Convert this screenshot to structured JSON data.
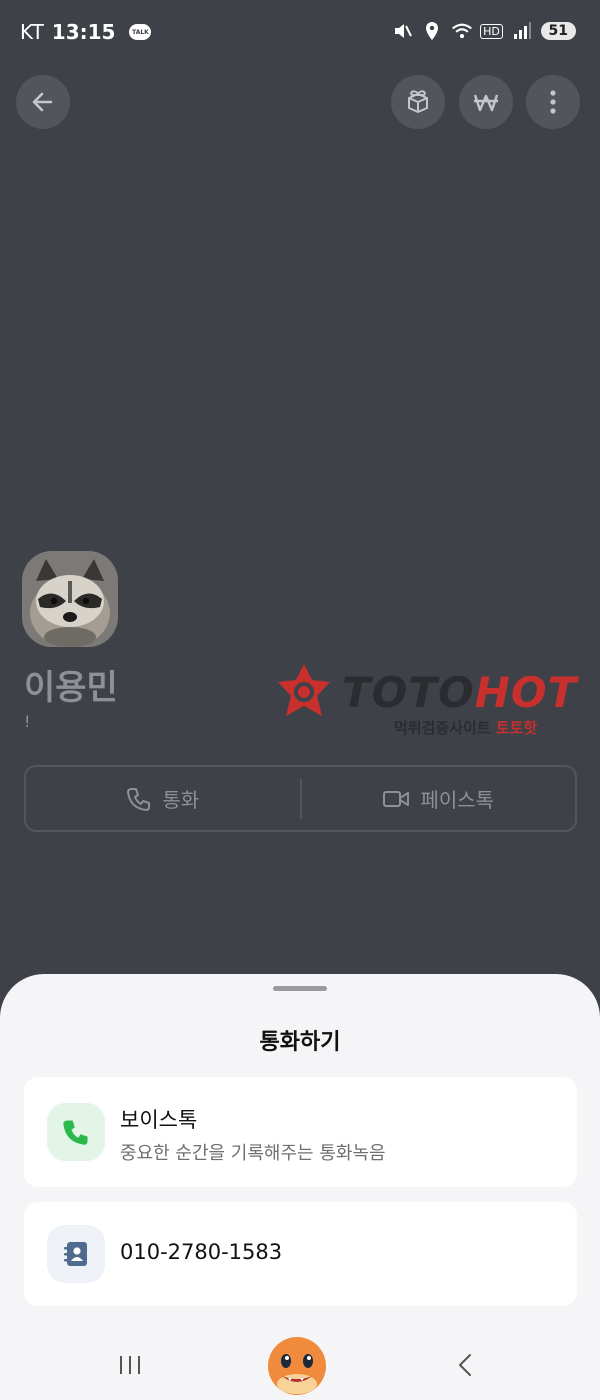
{
  "status_bar": {
    "carrier": "KT",
    "time": "13:15",
    "talk_badge": "TALK",
    "network_5g": "5",
    "hd": "HD",
    "battery": "51"
  },
  "top_actions": {
    "back": "back-arrow-icon",
    "gift": "gift-icon",
    "pay": "won-icon",
    "more": "more-vertical-icon"
  },
  "profile": {
    "name": "이용민",
    "status_message": "!"
  },
  "watermark": {
    "brand_part1": "TOTO",
    "brand_part2": "HOT",
    "tagline": "먹튀검증사이트 ",
    "tagline_accent": "토토핫"
  },
  "call_bar": {
    "voice_label": "통화",
    "face_label": "페이스톡"
  },
  "sheet": {
    "title": "통화하기",
    "options": [
      {
        "title": "보이스톡",
        "subtitle": "중요한 순간을 기록해주는 통화녹음"
      },
      {
        "title": "010-2780-1583"
      }
    ]
  },
  "colors": {
    "background": "#3e4148",
    "sheet": "#f5f5f7",
    "voicetalk_green": "#2cb84d",
    "contact_blue": "#4f6b8d",
    "watermark_red": "#c8302e"
  }
}
